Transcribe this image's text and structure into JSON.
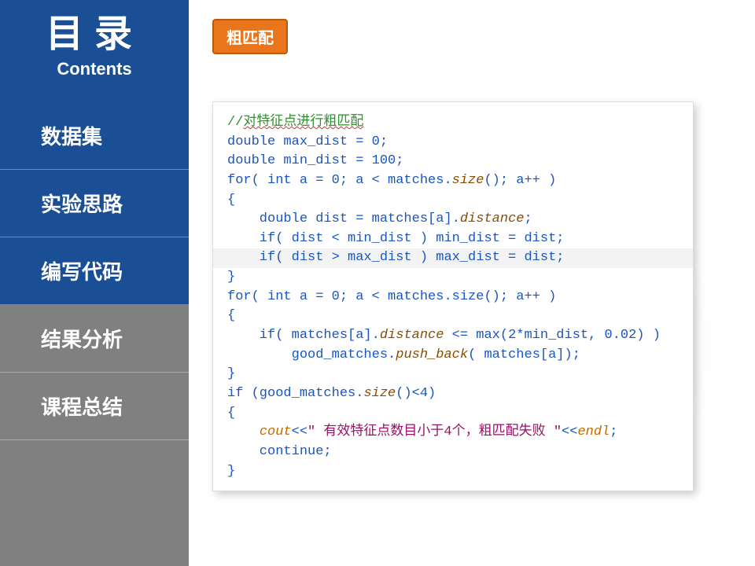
{
  "sidebar": {
    "title": "目录",
    "subtitle": "Contents",
    "items": [
      {
        "label": "数据集",
        "active": false,
        "tone": "blue"
      },
      {
        "label": "实验思路",
        "active": false,
        "tone": "blue"
      },
      {
        "label": "编写代码",
        "active": true,
        "tone": "blue"
      },
      {
        "label": "结果分析",
        "active": false,
        "tone": "grey"
      },
      {
        "label": "课程总结",
        "active": false,
        "tone": "grey"
      }
    ]
  },
  "main": {
    "badge_label": "粗匹配",
    "code": {
      "comment_prefix": "//",
      "comment_text": "对特征点进行粗匹配",
      "line_decl_max": "double max_dist = 0;",
      "line_decl_min": "double min_dist = 100;",
      "for_head": "for( int a = 0; a < matches.",
      "size_call": "size",
      "for_tail": "(); a++ )",
      "brace_open": "{",
      "dist_line_lead": "    double dist = matches[a].",
      "distance_word": "distance",
      "dist_line_tail": ";",
      "if_min": "    if( dist < min_dist ) min_dist = dist;",
      "if_max": "    if( dist > max_dist ) max_dist = dist;",
      "brace_close": "}",
      "for2_head": "for( int a = 0; a < matches.size(); a++ )",
      "if_good_lead": "    if( matches[a].",
      "if_good_mid": " <= max(2*min_dist, 0.02) )",
      "push_lead": "        good_matches.",
      "push_func": "push_back",
      "push_tail": "( matches[a]);",
      "if_count": "if (good_matches.",
      "if_count_tail": "()<4)",
      "cout_lead": "    ",
      "cout_kw": "cout",
      "cout_op": "<<",
      "cout_str": "\" 有效特征点数目小于4个，粗匹配失败 \"",
      "cout_endl": "endl",
      "continue_line": "    continue;"
    }
  }
}
